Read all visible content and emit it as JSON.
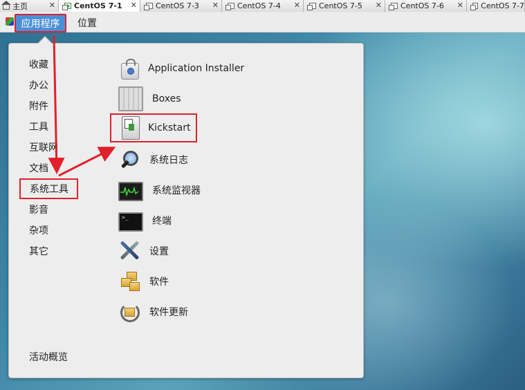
{
  "tabs": [
    {
      "label": "主页",
      "icon": "home-icon",
      "active": false
    },
    {
      "label": "CentOS 7-1",
      "icon": "vm-running-icon",
      "active": true
    },
    {
      "label": "CentOS 7-3",
      "icon": "vm-icon",
      "active": false
    },
    {
      "label": "CentOS 7-4",
      "icon": "vm-icon",
      "active": false
    },
    {
      "label": "CentOS 7-5",
      "icon": "vm-icon",
      "active": false
    },
    {
      "label": "CentOS 7-6",
      "icon": "vm-icon",
      "active": false
    },
    {
      "label": "CentOS 7-7",
      "icon": "vm-icon",
      "active": false
    }
  ],
  "tab_close": "✕",
  "panel": {
    "applications": "应用程序",
    "places": "位置"
  },
  "categories": [
    "收藏",
    "办公",
    "附件",
    "工具",
    "互联网",
    "文档",
    "系统工具",
    "影音",
    "杂项",
    "其它"
  ],
  "selected_category": "系统工具",
  "overview": "活动概览",
  "apps": [
    {
      "label": "Application Installer",
      "icon": "software-bag-icon"
    },
    {
      "label": "Boxes",
      "icon": "boxes-icon"
    },
    {
      "label": "Kickstart",
      "icon": "kickstart-icon"
    },
    {
      "label": "系统日志",
      "icon": "magnifier-icon"
    },
    {
      "label": "系统监视器",
      "icon": "system-monitor-icon"
    },
    {
      "label": "终端",
      "icon": "terminal-icon"
    },
    {
      "label": "设置",
      "icon": "tools-icon"
    },
    {
      "label": "软件",
      "icon": "packages-icon"
    },
    {
      "label": "软件更新",
      "icon": "software-update-icon"
    }
  ],
  "highlight_color": "#e0202a",
  "accent": "#4a90d9"
}
